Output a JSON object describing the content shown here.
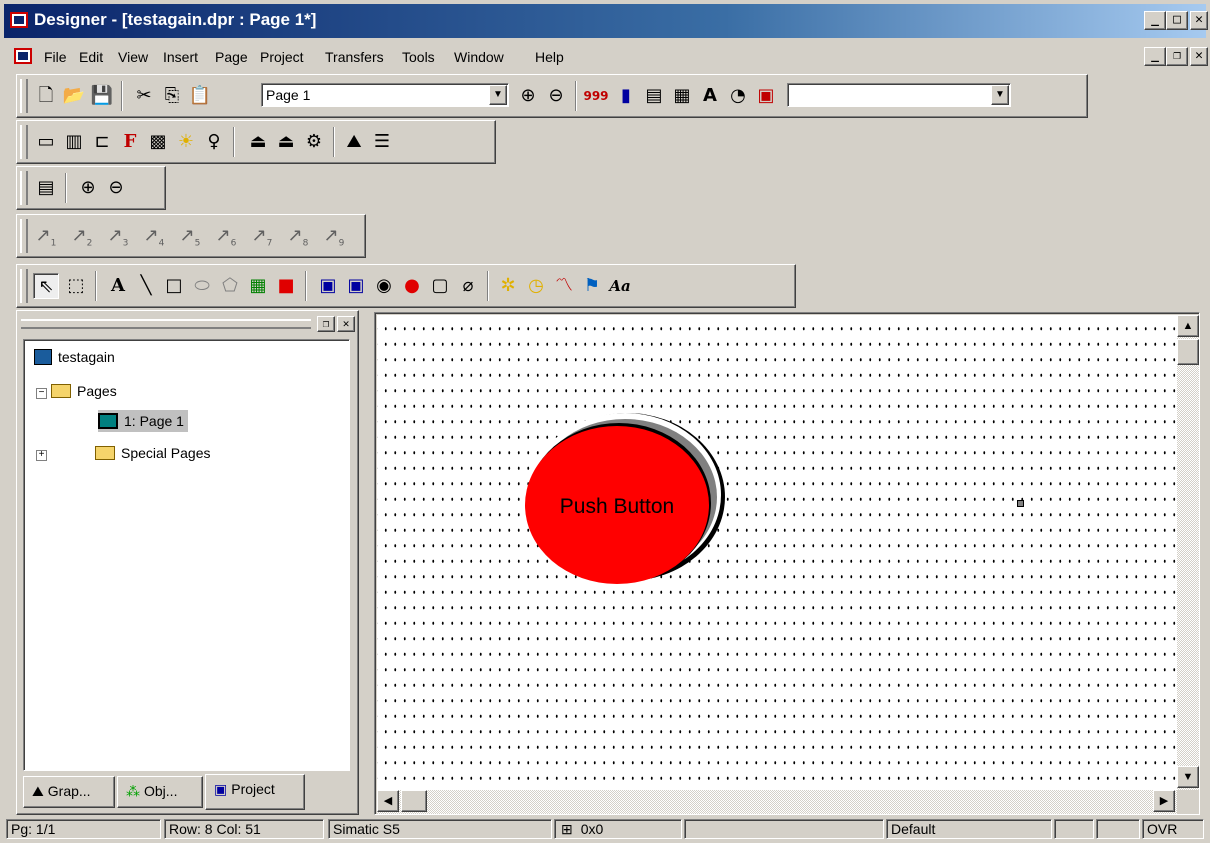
{
  "window": {
    "title": "Designer - [testagain.dpr : Page 1*]"
  },
  "menu": [
    "File",
    "Edit",
    "View",
    "Insert",
    "Page",
    "Project",
    "Transfers",
    "Tools",
    "Window",
    "Help"
  ],
  "toolbar": {
    "page_combo_value": "Page 1",
    "second_combo_value": ""
  },
  "tree": {
    "project": "testagain",
    "pages": "Pages",
    "page1": "1: Page 1",
    "special": "Special Pages"
  },
  "tabs": [
    "Grap...",
    "Obj...",
    "Project"
  ],
  "canvas": {
    "button_label": "Push Button",
    "button_color": "#ff0000"
  },
  "tool_numbers": [
    "1",
    "2",
    "3",
    "4",
    "5",
    "6",
    "7",
    "8",
    "9"
  ],
  "status": {
    "page": "Pg: 1/1",
    "rowcol": "Row: 8  Col: 51",
    "driver": "Simatic S5",
    "size": "0x0",
    "style": "Default",
    "mode": "OVR"
  }
}
